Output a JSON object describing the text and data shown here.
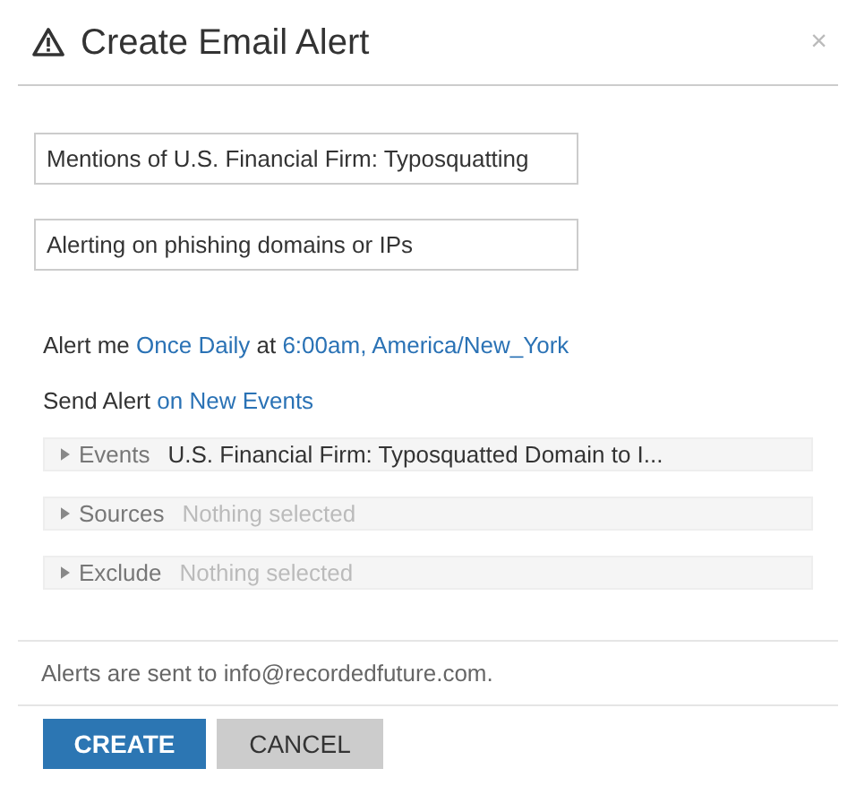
{
  "dialog": {
    "title": "Create Email Alert",
    "close": "×"
  },
  "fields": [
    {
      "value": "Mentions of U.S. Financial Firm: Typosquatting"
    },
    {
      "value": "Alerting on phishing domains or IPs"
    }
  ],
  "schedule": [
    {
      "text": "Alert me",
      "kind": "plain"
    },
    {
      "text": "Once Daily",
      "kind": "link"
    },
    {
      "text": "at",
      "kind": "plain"
    },
    {
      "text": "6:00am,",
      "kind": "link"
    },
    {
      "text": "America/New_York",
      "kind": "link"
    }
  ],
  "send": [
    {
      "text": "Send Alert",
      "kind": "plain"
    },
    {
      "text": "on New Events",
      "kind": "link"
    }
  ],
  "filters": [
    {
      "label": "Events",
      "value": "U.S. Financial Firm: Typosquatted Domain to I...",
      "expanded": false
    },
    {
      "label": "Sources",
      "placeholder": "Nothing selected",
      "expanded": false
    },
    {
      "label": "Exclude",
      "placeholder": "Nothing selected",
      "expanded": false
    }
  ],
  "footer_note": "Alerts are sent to info@recordedfuture.com.",
  "buttons": [
    {
      "label": "CREATE",
      "kind": "primary"
    },
    {
      "label": "CANCEL",
      "kind": "secondary"
    }
  ]
}
